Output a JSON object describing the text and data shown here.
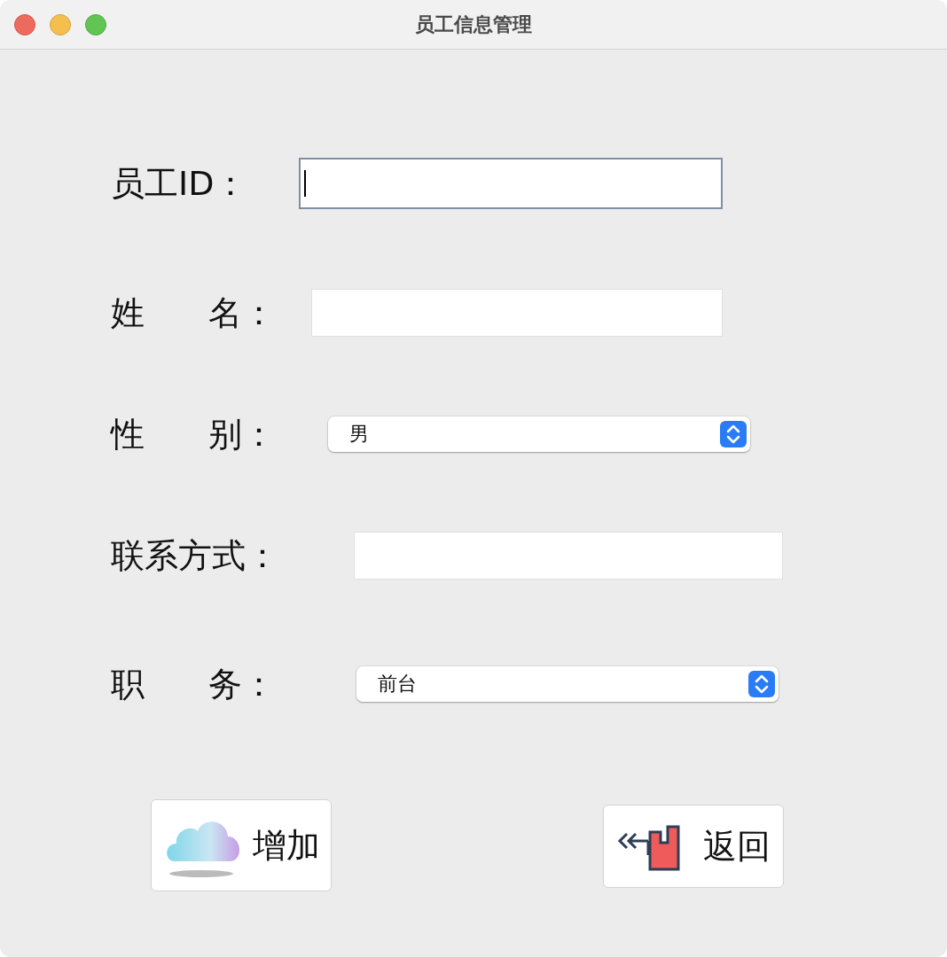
{
  "window": {
    "title": "员工信息管理"
  },
  "fields": [
    {
      "kind": "text",
      "label": "员工ID：",
      "focused": true
    },
    {
      "kind": "text",
      "label": "姓      名：",
      "focused": false
    },
    {
      "kind": "select",
      "label": "性      别：",
      "value": "男"
    },
    {
      "kind": "text",
      "label": "联系方式：",
      "focused": false
    },
    {
      "kind": "select",
      "label": "职      务：",
      "value": "前台"
    }
  ],
  "buttons": [
    {
      "kind": "add",
      "label": "增加"
    },
    {
      "kind": "back",
      "label": "返回"
    }
  ]
}
